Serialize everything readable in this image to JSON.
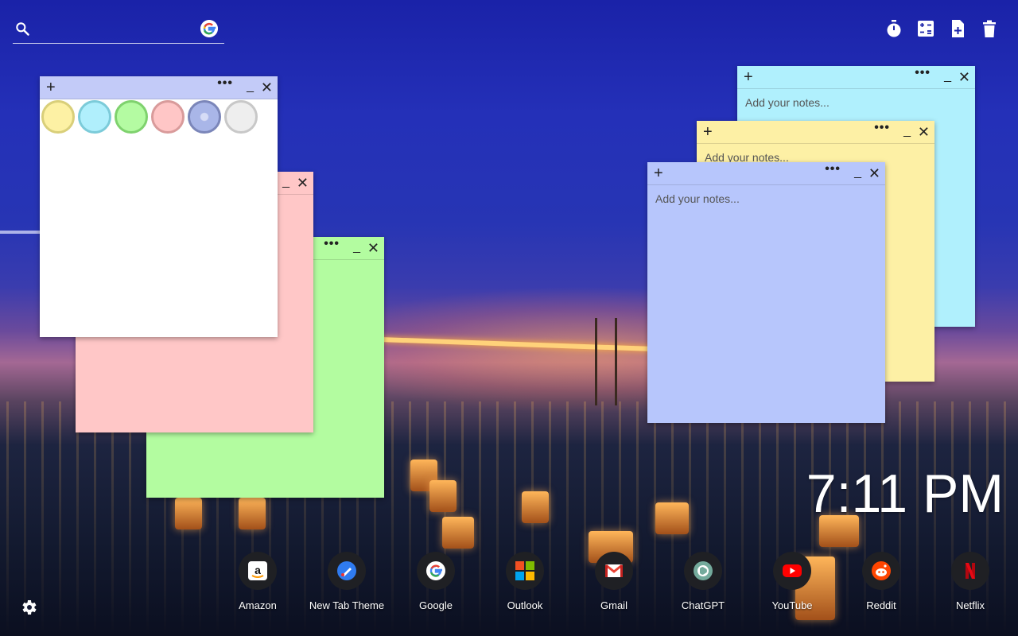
{
  "search": {
    "placeholder": "",
    "icon": "search-icon",
    "engine_icon": "google-icon"
  },
  "top_actions": [
    {
      "name": "timer-icon"
    },
    {
      "name": "calculator-icon"
    },
    {
      "name": "add-note-icon"
    },
    {
      "name": "delete-icon"
    }
  ],
  "notes": {
    "white": {
      "bg": "#ffffff",
      "header": "#c3cbf8"
    },
    "pink": {
      "bg": "#ffc7c7",
      "header": "#ffc7c7"
    },
    "green": {
      "bg": "#b3fca0",
      "header": "#b3fca0"
    },
    "cyan": {
      "bg": "#b0f0fd",
      "header": "#b0f0fd",
      "placeholder": "Add your notes..."
    },
    "yellow": {
      "bg": "#fdf0a5",
      "header": "#fdf0a5",
      "placeholder": "Add your notes..."
    },
    "blue": {
      "bg": "#b7c6fc",
      "header": "#b7c6fc",
      "placeholder": "Add your notes..."
    },
    "glyphs": {
      "plus": "+",
      "more": "•••",
      "minimize": "_",
      "close": "✕"
    }
  },
  "swatch_colors": [
    {
      "fill": "#fdf1a4",
      "border": "#d9cf7a"
    },
    {
      "fill": "#b0effc",
      "border": "#7ccbd9"
    },
    {
      "fill": "#b4fba2",
      "border": "#7fd26e"
    },
    {
      "fill": "#ffc6c6",
      "border": "#d99b9b"
    },
    {
      "fill": "#a9b6e8",
      "border": "#7b86b9"
    },
    {
      "fill": "#eeeeee",
      "border": "#c8c8c8"
    }
  ],
  "clock": {
    "time": "7:11 PM"
  },
  "apps": [
    {
      "label": "Amazon",
      "icon": "amazon-icon"
    },
    {
      "label": "New Tab Theme",
      "icon": "new-tab-theme-icon"
    },
    {
      "label": "Google",
      "icon": "google-icon"
    },
    {
      "label": "Outlook",
      "icon": "outlook-icon"
    },
    {
      "label": "Gmail",
      "icon": "gmail-icon"
    },
    {
      "label": "ChatGPT",
      "icon": "chatgpt-icon"
    },
    {
      "label": "YouTube",
      "icon": "youtube-icon"
    },
    {
      "label": "Reddit",
      "icon": "reddit-icon"
    },
    {
      "label": "Netflix",
      "icon": "netflix-icon"
    }
  ],
  "settings": {
    "icon": "gear-icon"
  }
}
